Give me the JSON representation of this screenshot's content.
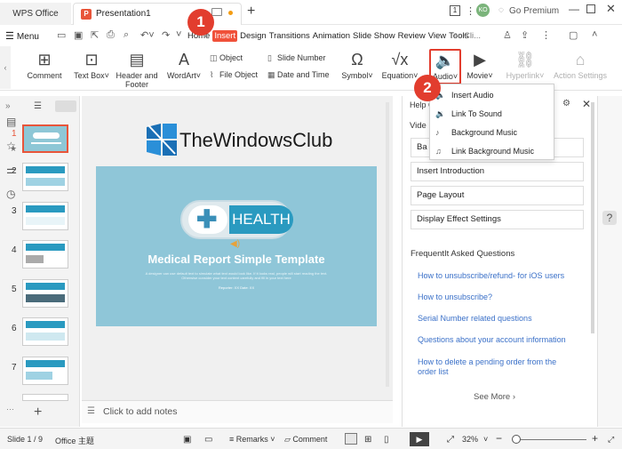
{
  "titlebar": {
    "app_tab": "WPS Office",
    "doc_tab": "Presentation1",
    "logo_letter": "P",
    "avatar_initials": "KO",
    "go_premium": "Go Premium",
    "new_tab_symbol": "+"
  },
  "menubar": {
    "menu_label": "Menu",
    "tabs": [
      "Home",
      "Insert",
      "Design",
      "Transitions",
      "Animation",
      "Slide Show",
      "Review",
      "View",
      "Tools"
    ],
    "active_tab": "Insert",
    "search_placeholder": "Cli..."
  },
  "ribbon": {
    "comment": "Comment",
    "text_box": "Text Box",
    "header_footer_1": "Header and",
    "header_footer_2": "Footer",
    "wordart": "WordArt",
    "object": "Object",
    "file_object": "File Object",
    "slide_number": "Slide Number",
    "date_time": "Date and Time",
    "symbol": "Symbol",
    "equation": "Equation",
    "audio": "Audio",
    "movie": "Movie",
    "hyperlink": "Hyperlink",
    "action_settings": "Action Settings"
  },
  "annotations": {
    "badge1": "1",
    "badge2": "2"
  },
  "audio_menu": {
    "items": [
      "Insert Audio",
      "Link To Sound",
      "Background Music",
      "Link Background Music"
    ]
  },
  "slides": {
    "numbers": [
      "1",
      "2",
      "3",
      "4",
      "5",
      "6",
      "7"
    ],
    "add_symbol": "+"
  },
  "slide_content": {
    "health_label": "HEALTH",
    "title": "Medical Report Simple Template",
    "subtitle": "A designer can use default text to simulate what text would look like. If it looks real, people will start reading the text. Otherwise consider your text content carefully and fill in your text here",
    "date_line": "Reporter: XX    Date: XX"
  },
  "watermark": {
    "text": "TheWindowsClub"
  },
  "notes": {
    "placeholder": "Click to add notes"
  },
  "help_pane": {
    "title": "Help C",
    "video_label": "Vide",
    "rows": [
      "Ba",
      "Insert Introduction",
      "Page Layout",
      "Display Effect Settings"
    ],
    "faq_title": "FrequentIt Asked Questions",
    "faqs": [
      "How to unsubscribe/refund- for iOS users",
      "How to unsubscribe?",
      "Serial Number related questions",
      "Questions about your account information",
      "How to delete a pending order from the order list"
    ],
    "see_more": "See More"
  },
  "statusbar": {
    "slide_info": "Slide 1 / 9",
    "theme": "Office 主题",
    "remarks": "Remarks",
    "comment": "Comment",
    "zoom": "32%"
  },
  "colors": {
    "accent": "#e8553a",
    "badge": "#e23d2e",
    "link": "#3a70c8",
    "slide_bg": "#8fc6d8"
  }
}
